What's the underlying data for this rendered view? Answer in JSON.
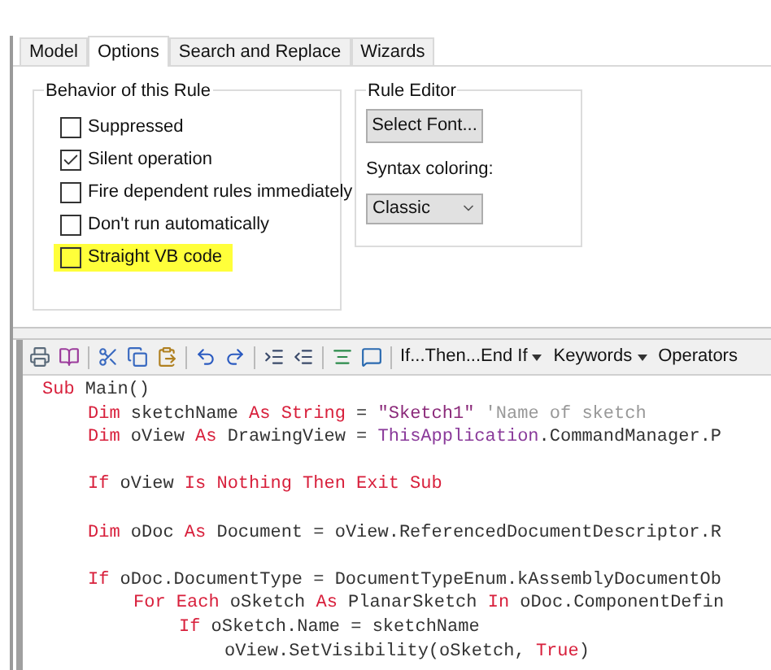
{
  "tabs": [
    {
      "label": "Model",
      "selected": false
    },
    {
      "label": "Options",
      "selected": true
    },
    {
      "label": "Search and Replace",
      "selected": false
    },
    {
      "label": "Wizards",
      "selected": false
    }
  ],
  "behavior_group": {
    "title": "Behavior of this Rule",
    "options": [
      {
        "label": "Suppressed",
        "checked": false,
        "highlighted": false
      },
      {
        "label": "Silent operation",
        "checked": true,
        "highlighted": false
      },
      {
        "label": "Fire dependent rules immediately",
        "checked": false,
        "highlighted": false
      },
      {
        "label": "Don't run automatically",
        "checked": false,
        "highlighted": false
      },
      {
        "label": "Straight VB code",
        "checked": false,
        "highlighted": true
      }
    ]
  },
  "rule_editor_group": {
    "title": "Rule Editor",
    "font_button": "Select Font...",
    "syntax_label": "Syntax coloring:",
    "syntax_value": "Classic"
  },
  "toolbar": {
    "dropdowns": [
      {
        "label": "If...Then...End If",
        "caret": true
      },
      {
        "label": "Keywords",
        "caret": true
      },
      {
        "label": "Operators",
        "caret": false
      }
    ]
  },
  "code_lines": [
    {
      "kind": "code",
      "tokens": [
        {
          "kind": "kw",
          "text": "Sub"
        },
        {
          "kind": "id",
          "text": " Main()"
        }
      ],
      "children": [
        {
          "kind": "code",
          "tokens": [
            {
              "kind": "kw",
              "text": "Dim"
            },
            {
              "kind": "id",
              "text": " sketchName "
            },
            {
              "kind": "kw",
              "text": "As"
            },
            {
              "kind": "kw",
              "text": " String"
            },
            {
              "kind": "id",
              "text": " = "
            },
            {
              "kind": "str",
              "text": "\"Sketch1\""
            },
            {
              "kind": "cmt",
              "text": " 'Name of sketch"
            }
          ]
        },
        {
          "kind": "code",
          "tokens": [
            {
              "kind": "kw",
              "text": "Dim"
            },
            {
              "kind": "id",
              "text": " oView "
            },
            {
              "kind": "kw",
              "text": "As"
            },
            {
              "kind": "id",
              "text": " DrawingView = "
            },
            {
              "kind": "obj",
              "text": "ThisApplication"
            },
            {
              "kind": "id",
              "text": ".CommandManager.P"
            }
          ]
        },
        {
          "kind": "blank"
        },
        {
          "kind": "code",
          "tokens": [
            {
              "kind": "kw",
              "text": "If"
            },
            {
              "kind": "id",
              "text": " oView "
            },
            {
              "kind": "kw",
              "text": "Is Nothing Then Exit Sub"
            }
          ]
        },
        {
          "kind": "blank"
        },
        {
          "kind": "code",
          "tokens": [
            {
              "kind": "kw",
              "text": "Dim"
            },
            {
              "kind": "id",
              "text": " oDoc "
            },
            {
              "kind": "kw",
              "text": "As"
            },
            {
              "kind": "id",
              "text": " Document = oView.ReferencedDocumentDescriptor.R"
            }
          ]
        },
        {
          "kind": "blank"
        },
        {
          "kind": "code",
          "tokens": [
            {
              "kind": "kw",
              "text": "If"
            },
            {
              "kind": "id",
              "text": " oDoc.DocumentType = DocumentTypeEnum.kAssemblyDocumentOb"
            }
          ],
          "children": [
            {
              "kind": "code",
              "tokens": [
                {
                  "kind": "kw",
                  "text": "For Each"
                },
                {
                  "kind": "id",
                  "text": " oSketch "
                },
                {
                  "kind": "kw",
                  "text": "As"
                },
                {
                  "kind": "id",
                  "text": " PlanarSketch "
                },
                {
                  "kind": "kw",
                  "text": "In"
                },
                {
                  "kind": "id",
                  "text": " oDoc.ComponentDefin"
                }
              ],
              "children": [
                {
                  "kind": "code",
                  "tokens": [
                    {
                      "kind": "kw",
                      "text": "If"
                    },
                    {
                      "kind": "id",
                      "text": " oSketch.Name = sketchName"
                    }
                  ],
                  "children": [
                    {
                      "kind": "code",
                      "tokens": [
                        {
                          "kind": "id",
                          "text": "oView.SetVisibility(oSketch, "
                        },
                        {
                          "kind": "kw",
                          "text": "True"
                        },
                        {
                          "kind": "id",
                          "text": ")"
                        }
                      ]
                    }
                  ]
                }
              ]
            }
          ]
        }
      ]
    }
  ]
}
